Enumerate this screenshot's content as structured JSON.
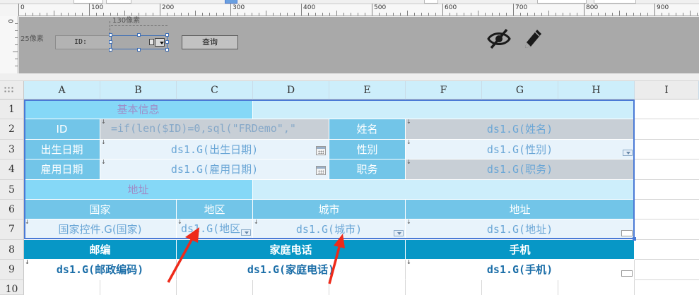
{
  "ruler": {
    "h_labels": [
      "0",
      "100",
      "200",
      "300",
      "400",
      "500",
      "600",
      "700",
      "800",
      "900"
    ],
    "v_label": "0"
  },
  "param_pane": {
    "width_note": "130像素",
    "height_note": "25像素",
    "id_label": "ID:",
    "query_button": "查询"
  },
  "icons": {
    "hide": "eye-slash-icon",
    "edit": "pencil-icon",
    "grid_menu": "grid-dots-icon"
  },
  "grid": {
    "columns": [
      "A",
      "B",
      "C",
      "D",
      "E",
      "F",
      "G",
      "H",
      "I"
    ],
    "rows": [
      "1",
      "2",
      "3",
      "4",
      "5",
      "6",
      "7",
      "8",
      "9",
      "10"
    ]
  },
  "cells": {
    "basic_info": "基本信息",
    "id": "ID",
    "id_formula": "=if(len($ID)=0,sql(\"FRDemo\",\"",
    "name_label": "姓名",
    "name_value": "ds1.G(姓名)",
    "birth_label": "出生日期",
    "birth_value": "ds1.G(出生日期)",
    "gender_label": "性别",
    "gender_value": "ds1.G(性别)",
    "hire_label": "雇用日期",
    "hire_value": "ds1.G(雇用日期)",
    "job_label": "职务",
    "job_value": "ds1.G(职务)",
    "address_title": "地址",
    "country": "国家",
    "region": "地区",
    "city": "城市",
    "address": "地址",
    "country_value": "国家控件.G(国家)",
    "region_value": "ds1.G(地区",
    "city_value": "ds1.G(城市)",
    "address_value": "ds1.G(地址)",
    "zip": "邮编",
    "home_phone": "家庭电话",
    "mobile": "手机",
    "zip_value": "ds1.G(邮政编码)",
    "home_phone_value": "ds1.G(家庭电话)",
    "mobile_value": "ds1.G(手机)"
  },
  "colors": {
    "light_cyan": "#cdeefb",
    "bright_cyan": "#85d8f7",
    "mid_blue": "#72c5e8",
    "dark_teal": "#0797c6",
    "grey_cell": "#c8cfd6",
    "pale_cell": "#e8f3fb",
    "selection": "#4a7ad6",
    "arrow": "#ee2a1a"
  }
}
